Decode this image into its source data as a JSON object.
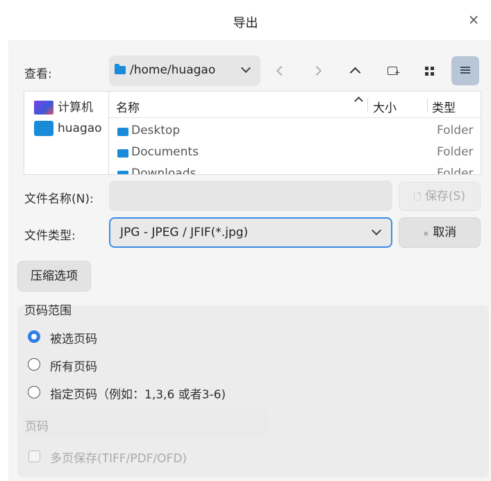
{
  "window": {
    "title": "导出"
  },
  "toolbar": {
    "look_in_label": "查看:",
    "path": "/home/huagao"
  },
  "places": [
    {
      "label": "计算机"
    },
    {
      "label": "huagao"
    }
  ],
  "files": {
    "headers": {
      "name": "名称",
      "size": "大小",
      "type": "类型"
    },
    "rows": [
      {
        "name": "Desktop",
        "type": "Folder"
      },
      {
        "name": "Documents",
        "type": "Folder"
      },
      {
        "name": "Downloads",
        "type": "Folder"
      }
    ]
  },
  "form": {
    "filename_label": "文件名称(N):",
    "filename_value": "",
    "filetype_label": "文件类型:",
    "filetype_value": "JPG - JPEG / JFIF(*.jpg)",
    "save_label": "保存(S)",
    "cancel_label": "取消",
    "compress_label": "压缩选项"
  },
  "page_range": {
    "title": "页码范围",
    "options": [
      {
        "label": "被选页码",
        "checked": true
      },
      {
        "label": "所有页码",
        "checked": false
      },
      {
        "label": "指定页码（例如：1,3,6 或者3-6)",
        "checked": false
      }
    ],
    "page_label": "页码",
    "multipage_label": "多页保存(TIFF/PDF/OFD)"
  },
  "colors": {
    "accent": "#2f7fe6",
    "folder": "#1a8bd8",
    "list_view_active": "#b9c6d8"
  }
}
